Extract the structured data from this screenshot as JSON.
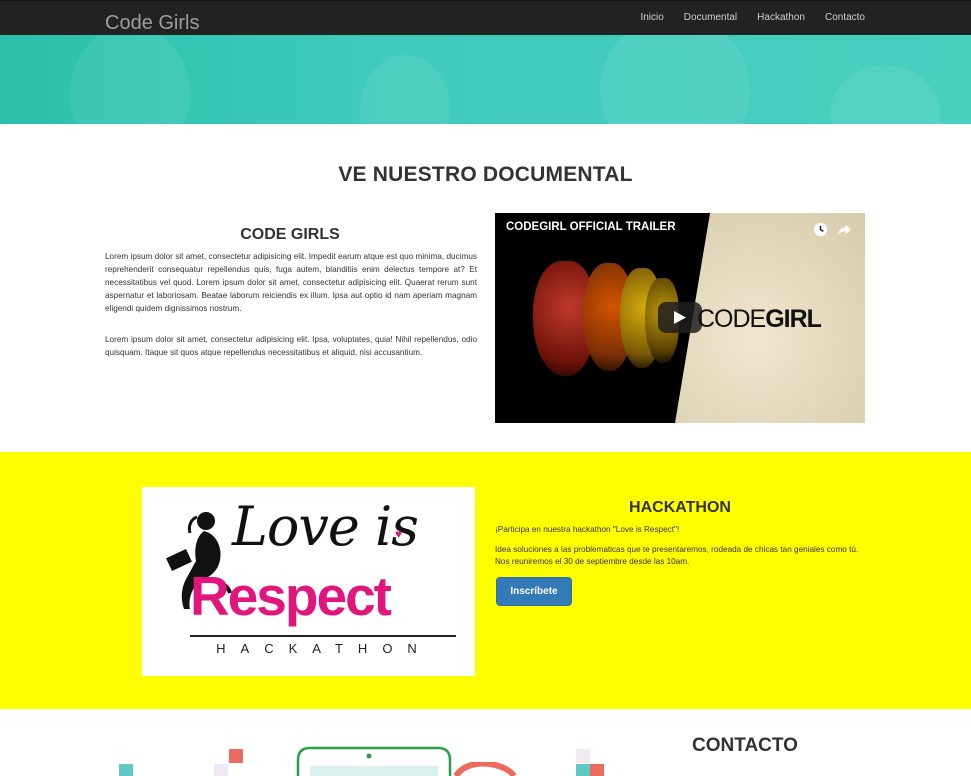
{
  "navbar": {
    "brand": "Code Girls",
    "links": [
      "Inicio",
      "Documental",
      "Hackathon",
      "Contacto"
    ]
  },
  "documental": {
    "heading": "VE NUESTRO DOCUMENTAL",
    "subheading": "CODE GIRLS",
    "paragraph1": "Lorem ipsum dolor sit amet, consectetur adipisicing elit. Impedit earum atque est quo minima, ducimus reprehenderit consequatur repellendus quis, fuga autem, blanditiis enim delectus tempore at? Et necessitatibus vel quod. Lorem ipsum dolor sit amet, consectetur adipisicing elit. Quaerat rerum sunt aspernatur et laboriosam. Beatae laborum reiciendis ex illum. Ipsa aut optio id nam aperiam magnam eligendi quidem dignissimos nostrum.",
    "paragraph2": "Lorem ipsum dolor sit amet, consectetur adipisicing elit. Ipsa, voluptates, quia! Nihil repellendus, odio quisquam. Itaque sit quos atque repellendus necessitatibus et aliquid, nisi accusantium.",
    "video": {
      "title": "CODEGIRL OFFICIAL TRAILER",
      "logo_light": "CODE",
      "logo_bold": "GIRL"
    }
  },
  "hackathon": {
    "logo_line1": "Love is",
    "logo_line2": "Respect",
    "logo_line3": "HACKATHON",
    "heading": "HACKATHON",
    "text1": "¡Participa en nuestra hackathon \"Love is Respect\"!",
    "text2": "Idea soluciones a las problematicas que te presentaremos, rodeada de chicas tan geniales como tú. Nos reuniremos el 30 de septiembre desde las 10am.",
    "button": "Inscríbete",
    "background_color": "#ffff00",
    "brand_pink": "#e0157e"
  },
  "contacto": {
    "heading": "CONTACTO"
  },
  "colors": {
    "navbar": "#222222",
    "hero": "#3fcbbd",
    "button": "#337ab7"
  }
}
